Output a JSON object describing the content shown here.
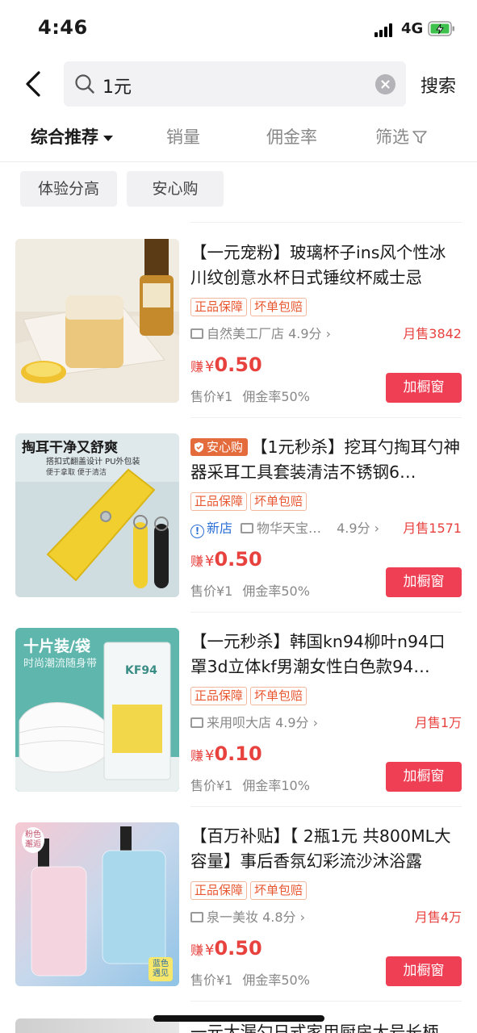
{
  "status_bar": {
    "time": "4:46",
    "network": "4G"
  },
  "search": {
    "query": "1元",
    "submit_label": "搜索"
  },
  "sort_tabs": [
    {
      "label": "综合推荐"
    },
    {
      "label": "销量"
    },
    {
      "label": "佣金率"
    },
    {
      "label": "筛选"
    }
  ],
  "filters": [
    {
      "label": "体验分高"
    },
    {
      "label": "安心购"
    }
  ],
  "products": [
    {
      "title": "【一元宠粉】玻璃杯子ins风个性冰川纹创意水杯日式锤纹杯威士忌",
      "tags": [
        "正品保障",
        "坏单包赔"
      ],
      "shop": "自然美工厂店",
      "rating": "4.9分",
      "sales": "月售3842",
      "earn_label": "赚",
      "currency": "¥",
      "earn": "0.50",
      "price": "售价¥1",
      "commission": "佣金率50%",
      "button": "加橱窗"
    },
    {
      "badge": "安心购",
      "title": "【1元秒杀】挖耳勺掏耳勺神器采耳工具套装清洁不锈钢6…",
      "tags": [
        "正品保障",
        "坏单包赔"
      ],
      "new_shop": "新店",
      "shop": "物华天宝…",
      "rating": "4.9分",
      "sales": "月售1571",
      "earn_label": "赚",
      "currency": "¥",
      "earn": "0.50",
      "price": "售价¥1",
      "commission": "佣金率50%",
      "button": "加橱窗",
      "image_text": {
        "headline": "掏耳干净又舒爽",
        "line1": "搭扣式翻盖设计 PU外包装",
        "line2": "便于拿取 便于清洁"
      }
    },
    {
      "title": "【一元秒杀】韩国kn94柳叶n94口罩3d立体kf男潮女性白色款94…",
      "tags": [
        "正品保障",
        "坏单包赔"
      ],
      "shop": "来用呗大店",
      "rating": "4.9分",
      "sales": "月售1万",
      "earn_label": "赚",
      "currency": "¥",
      "earn": "0.10",
      "price": "售价¥1",
      "commission": "佣金率10%",
      "button": "加橱窗",
      "image_text": {
        "headline": "十片装/袋",
        "sub": "时尚潮流随身带",
        "pack": "KF94"
      }
    },
    {
      "title": "【百万补贴】【 2瓶1元 共800ML大容量】事后香氛幻彩流沙沐浴露",
      "tags": [
        "正品保障",
        "坏单包赔"
      ],
      "shop": "泉一美妆",
      "rating": "4.8分",
      "sales": "月售4万",
      "earn_label": "赚",
      "currency": "¥",
      "earn": "0.50",
      "price": "售价¥1",
      "commission": "佣金率50%",
      "button": "加橱窗",
      "image_text": {
        "corner_top": "粉色邂逅",
        "corner_bottom": "蓝色遇见"
      }
    }
  ],
  "partial_item_title": "一元大漏勺日式家用厨房大号长柄"
}
